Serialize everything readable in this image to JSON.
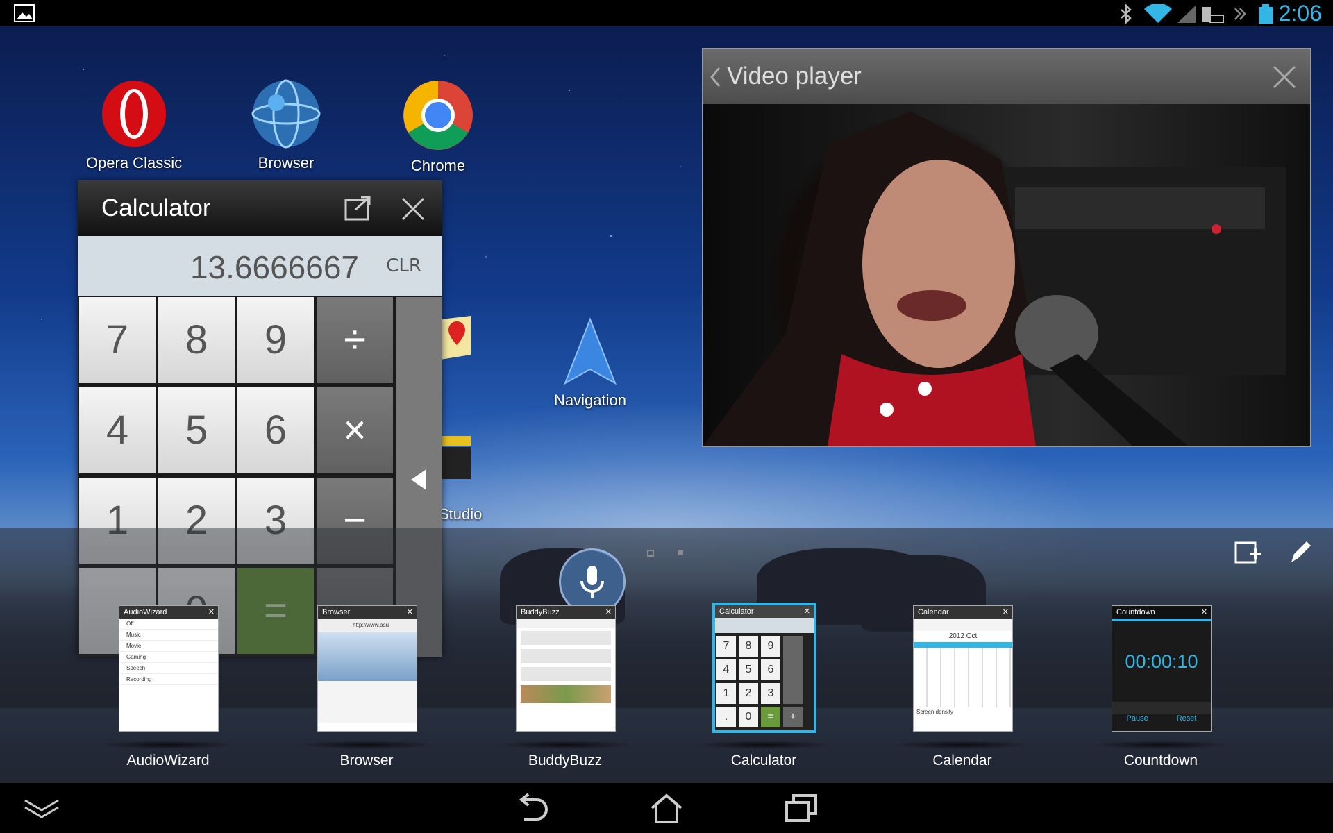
{
  "status": {
    "time": "2:06"
  },
  "desktop": {
    "icons": [
      {
        "label": "Opera Classic"
      },
      {
        "label": "Browser"
      },
      {
        "label": "Chrome"
      },
      {
        "label": "Navigation"
      },
      {
        "label": "Studio"
      }
    ]
  },
  "calculator": {
    "title": "Calculator",
    "display": "13.6666667",
    "clr": "CLR",
    "keys": [
      "7",
      "8",
      "9",
      "÷",
      "4",
      "5",
      "6",
      "×",
      "1",
      "2",
      "3",
      "−",
      "=",
      "0"
    ]
  },
  "video": {
    "title": "Video player"
  },
  "recents": {
    "apps": [
      {
        "label": "AudioWizard",
        "thumb_title": "AudioWizard",
        "items": [
          "Off",
          "Music",
          "Movie",
          "Gaming",
          "Speech",
          "Recording"
        ]
      },
      {
        "label": "Browser",
        "thumb_title": "Browser",
        "url": "http://www.asu"
      },
      {
        "label": "BuddyBuzz",
        "thumb_title": "BuddyBuzz"
      },
      {
        "label": "Calculator",
        "thumb_title": "Calculator",
        "keys": [
          "7",
          "8",
          "9",
          "4",
          "5",
          "6",
          "1",
          "2",
          "3",
          ".",
          "0",
          "=",
          "+"
        ]
      },
      {
        "label": "Calendar",
        "thumb_title": "Calendar",
        "month": "2012 Oct",
        "note": "Screen density"
      },
      {
        "label": "Countdown",
        "thumb_title": "Countdown",
        "timer": "00:00:10",
        "pause": "Pause",
        "reset": "Reset"
      }
    ]
  },
  "colors": {
    "accent": "#33b5e5",
    "equals": "#6a9a3c"
  }
}
